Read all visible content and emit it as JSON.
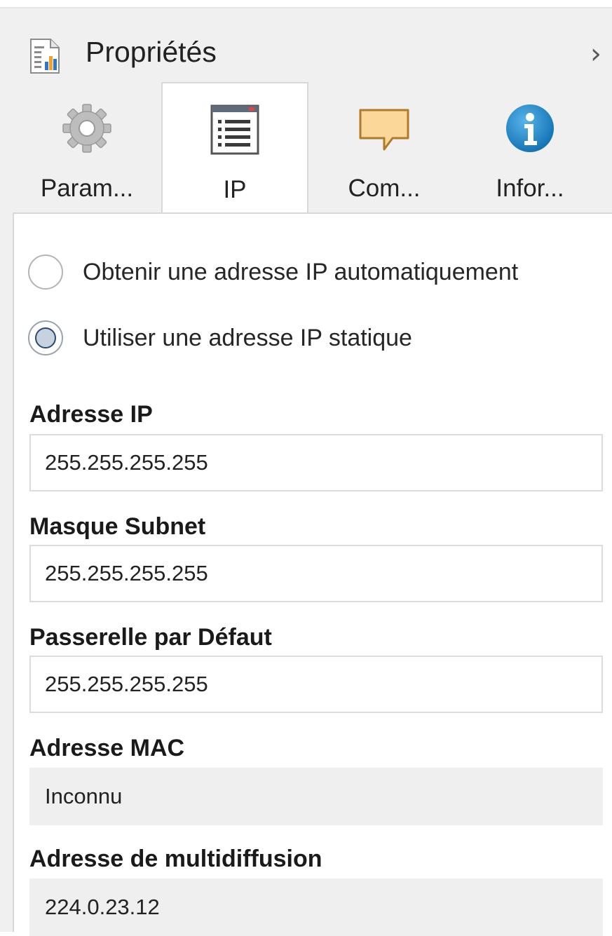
{
  "header": {
    "title": "Propriétés",
    "icon": "properties-chart-icon",
    "collapse_glyph": "›"
  },
  "tabs": [
    {
      "label": "Param...",
      "icon": "gear-icon",
      "active": false
    },
    {
      "label": "IP",
      "icon": "list-window-icon",
      "active": true
    },
    {
      "label": "Com...",
      "icon": "speech-bubble-icon",
      "active": false
    },
    {
      "label": "Infor...",
      "icon": "info-icon",
      "active": false
    }
  ],
  "ip": {
    "radio_auto": {
      "label": "Obtenir une adresse IP automatiquement",
      "checked": false
    },
    "radio_static": {
      "label": "Utiliser une adresse IP statique",
      "checked": true
    },
    "fields": {
      "ip_address": {
        "label": "Adresse IP",
        "value": "255.255.255.255"
      },
      "subnet_mask": {
        "label": "Masque Subnet",
        "value": "255.255.255.255"
      },
      "gateway": {
        "label": "Passerelle par Défaut",
        "value": "255.255.255.255"
      },
      "mac_address": {
        "label": "Adresse MAC",
        "value": "Inconnu"
      },
      "multicast": {
        "label": "Adresse de multidiffusion",
        "value": "224.0.23.12"
      }
    }
  },
  "colors": {
    "panel_bg": "#f0f0f0",
    "content_bg": "#ffffff",
    "readonly_bg": "#efefef",
    "radio_checked_fill": "#c7d2df",
    "radio_checked_ring": "#2b4a73",
    "info_blue": "#1e88c8",
    "bubble_orange": "#f7b860"
  }
}
